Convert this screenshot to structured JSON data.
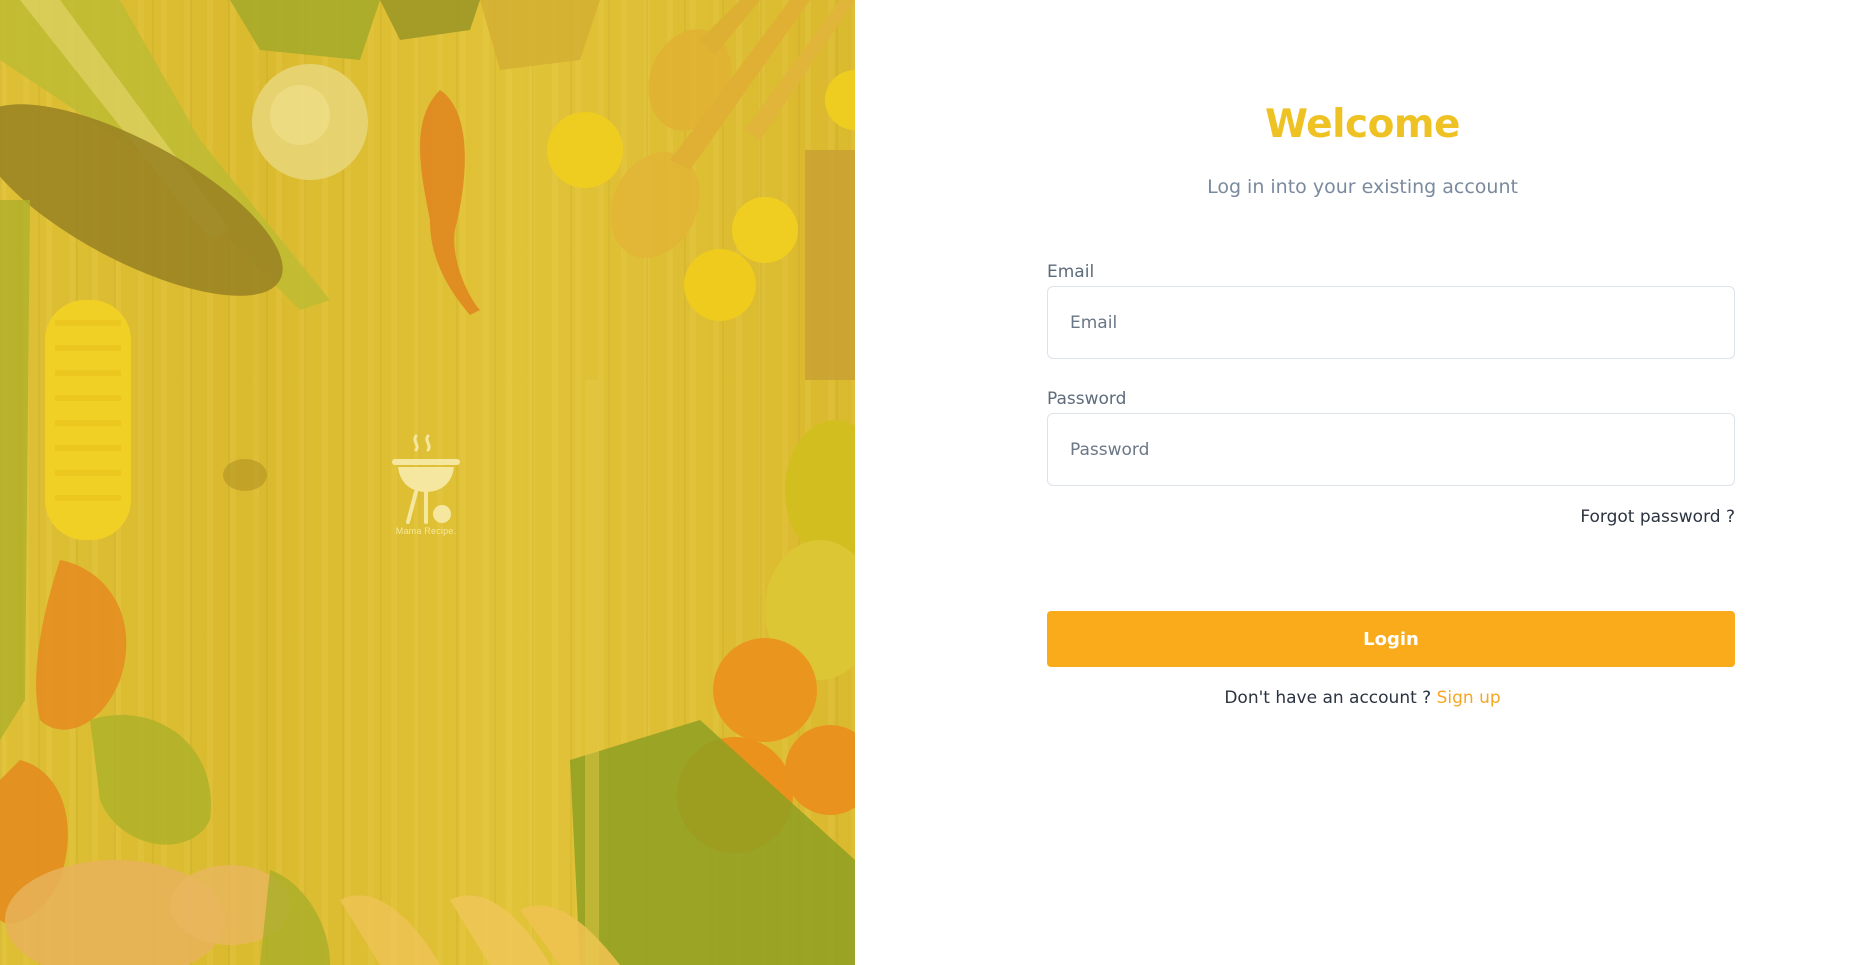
{
  "hero": {
    "logo_text": "Mama Recipe.",
    "overlay_color": "#ecc828",
    "background_description_icons": [
      "barbecue-grill-icon"
    ]
  },
  "login": {
    "title": "Welcome",
    "subtitle": "Log in into your existing account",
    "email_label": "Email",
    "email_placeholder": "Email",
    "password_label": "Password",
    "password_placeholder": "Password",
    "forgot_password": "Forgot password ?",
    "login_button": "Login",
    "no_account_text": "Don't have an account ?",
    "signup_link": "Sign up"
  },
  "colors": {
    "accent": "#efc223",
    "button": "#f9ab1b",
    "link": "#f6a623",
    "muted_text": "#7a8a9e"
  }
}
